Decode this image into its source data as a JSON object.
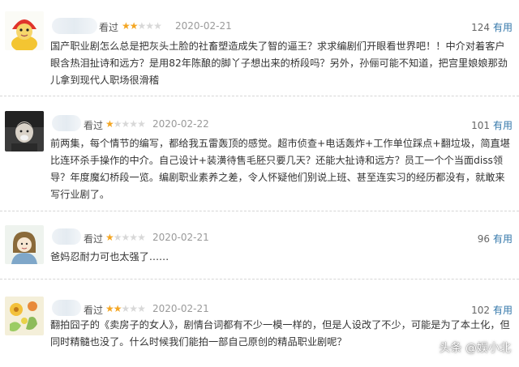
{
  "reviews": [
    {
      "watched_label": "看过",
      "rating": 2,
      "date": "2020-02-21",
      "useful_count": "124",
      "useful_label": "有用",
      "text": "国产职业剧怎么总是把灰头土脸的社畜塑造成失了智的逼王？求求编剧们开眼看世界吧！！中介对着客户眼含热泪扯诗和远方？是用82年陈酿的脚丫子想出来的桥段吗？另外，孙俪可能不知道，把宫里娘娘那劲儿拿到现代人职场很滑稽",
      "avatar_icon": "mascot-avatar-icon"
    },
    {
      "watched_label": "看过",
      "rating": 1,
      "date": "2020-02-22",
      "useful_count": "101",
      "useful_label": "有用",
      "text": "前两集，每个情节的编写，都给我五雷轰顶的感觉。超市侦查+电话轰炸+工作单位踩点+翻垃圾，简直堪比连环杀手操作的中介。自己设计+装潢待售毛胚只要几天？还能大扯诗和远方？员工一个个当面diss领导？年度魔幻桥段一览。编剧职业素养之差，令人怀疑他们别说上班、甚至连实习的经历都没有，就敢来写行业剧了。",
      "avatar_icon": "person-photo-avatar-icon"
    },
    {
      "watched_label": "看过",
      "rating": 1,
      "date": "2020-02-21",
      "useful_count": "96",
      "useful_label": "有用",
      "text": "爸妈忍耐力可也太强了……",
      "avatar_icon": "cartoon-girl-avatar-icon"
    },
    {
      "watched_label": "看过",
      "rating": 2,
      "date": "2020-02-21",
      "useful_count": "102",
      "useful_label": "有用",
      "text": "翻拍囧子的《卖房子的女人》，剧情台词都有不少一模一样的，但是人设改了不少，可能是为了本土化，但同时精髓也没了。什么时候我们能拍一部自己原创的精品职业剧呢？",
      "avatar_icon": "flower-avatar-icon"
    }
  ],
  "watermark": "头条 @娱小北",
  "colors": {
    "star_on": "#f4a623",
    "star_off": "#d8d8d8",
    "useful_link": "#3377aa",
    "date": "#9a9a9a"
  }
}
